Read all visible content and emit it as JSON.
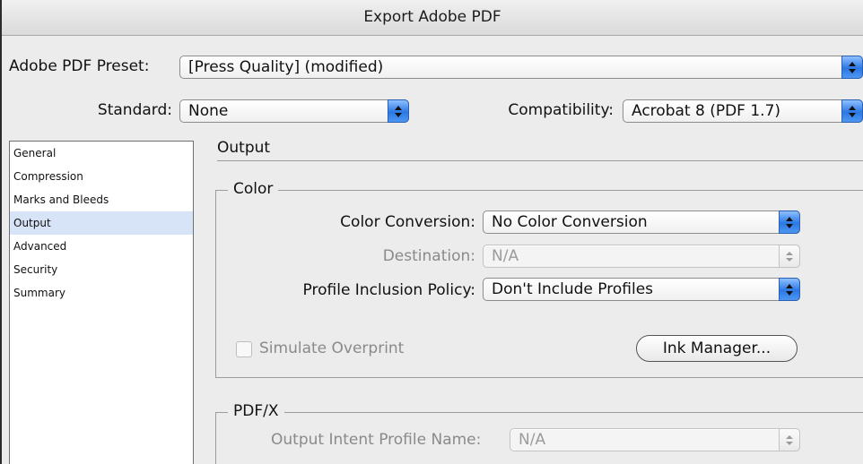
{
  "window": {
    "title": "Export Adobe PDF"
  },
  "preset": {
    "label": "Adobe PDF Preset:",
    "value": "[Press Quality] (modified)"
  },
  "standard": {
    "label": "Standard:",
    "value": "None"
  },
  "compatibility": {
    "label": "Compatibility:",
    "value": "Acrobat 8 (PDF 1.7)"
  },
  "sidebar": {
    "items": [
      {
        "label": "General"
      },
      {
        "label": "Compression"
      },
      {
        "label": "Marks and Bleeds"
      },
      {
        "label": "Output",
        "selected": true
      },
      {
        "label": "Advanced"
      },
      {
        "label": "Security"
      },
      {
        "label": "Summary"
      }
    ]
  },
  "main": {
    "title": "Output",
    "color_group": {
      "legend": "Color",
      "color_conversion": {
        "label": "Color Conversion:",
        "value": "No Color Conversion"
      },
      "destination": {
        "label": "Destination:",
        "value": "N/A",
        "enabled": false
      },
      "profile_inclusion": {
        "label": "Profile Inclusion Policy:",
        "value": "Don't Include Profiles"
      },
      "simulate_overprint": {
        "label": "Simulate Overprint",
        "checked": false,
        "enabled": false
      },
      "ink_manager_label": "Ink Manager..."
    },
    "pdfx_group": {
      "legend": "PDF/X",
      "output_intent": {
        "label": "Output Intent Profile Name:",
        "value": "N/A",
        "enabled": false
      }
    }
  },
  "colors": {
    "accent": "#2b78e4",
    "selection": "#d7e3f7"
  }
}
